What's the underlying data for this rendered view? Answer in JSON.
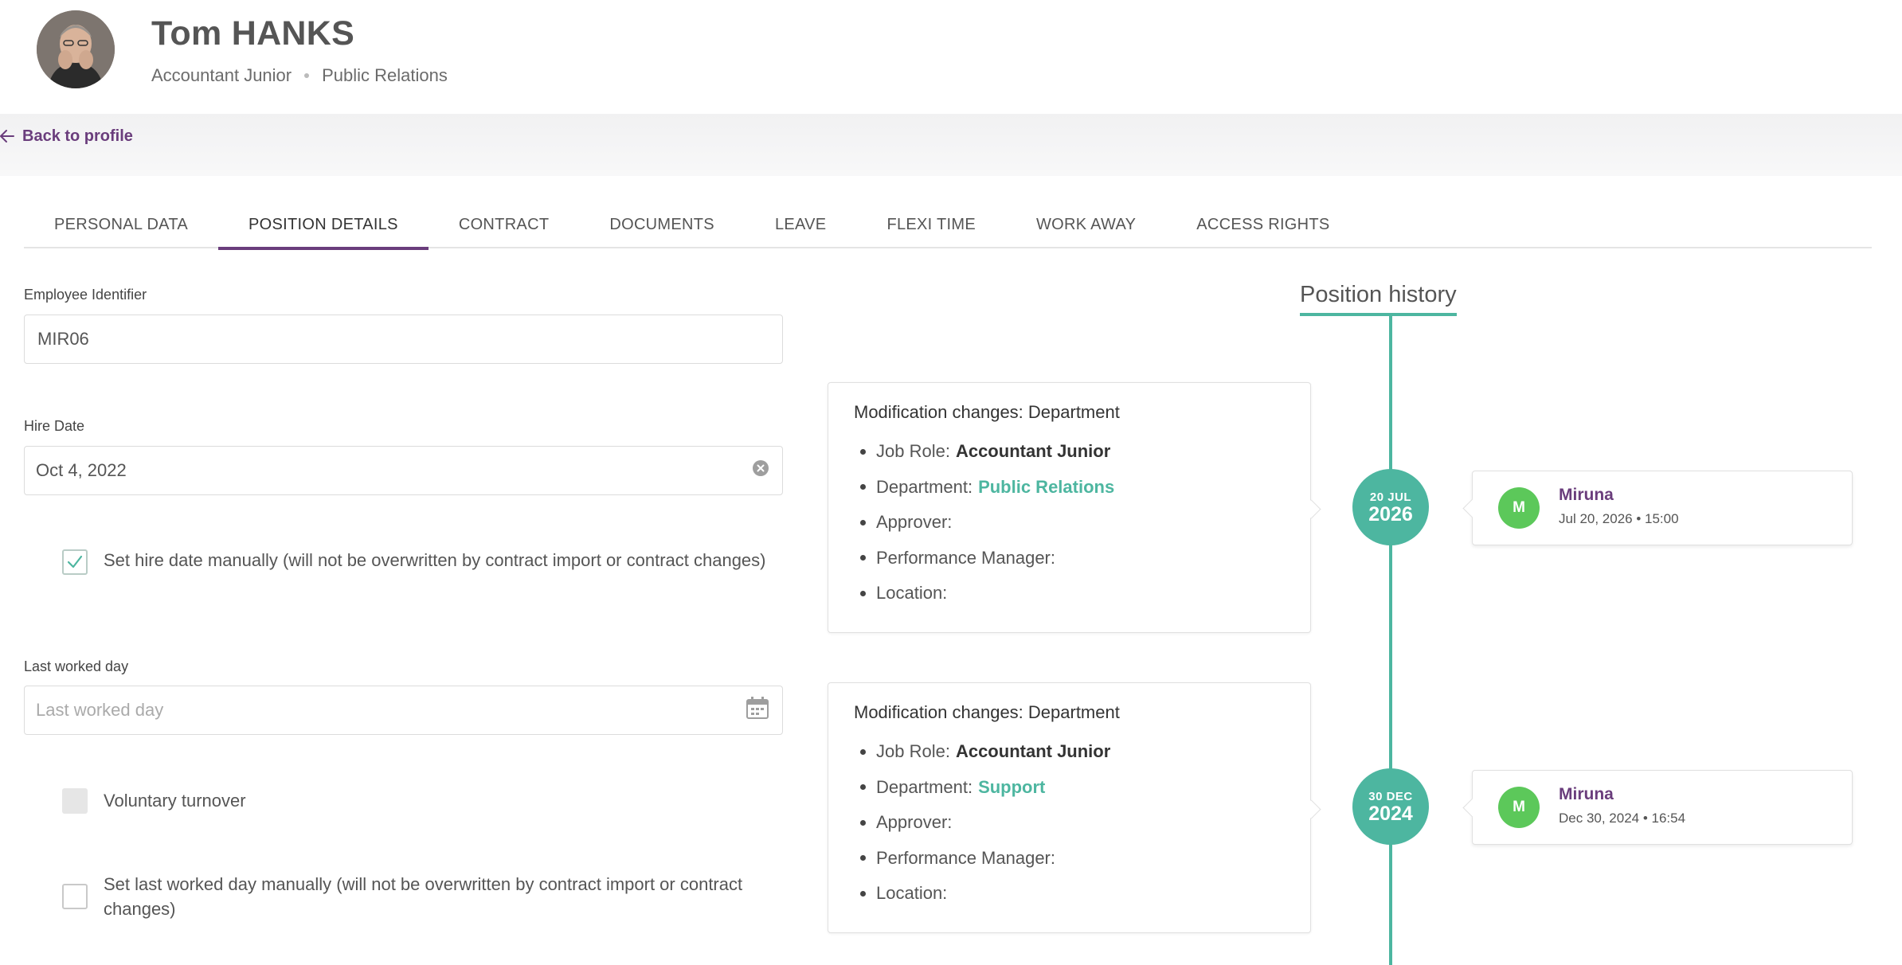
{
  "header": {
    "name": "Tom HANKS",
    "job_role": "Accountant Junior",
    "department": "Public Relations"
  },
  "nav": {
    "back_label": "Back to profile"
  },
  "tabs": [
    {
      "label": "PERSONAL DATA"
    },
    {
      "label": "POSITION DETAILS",
      "active": true
    },
    {
      "label": "CONTRACT"
    },
    {
      "label": "DOCUMENTS"
    },
    {
      "label": "LEAVE"
    },
    {
      "label": "FLEXI TIME"
    },
    {
      "label": "WORK AWAY"
    },
    {
      "label": "ACCESS RIGHTS"
    }
  ],
  "form": {
    "employee_identifier": {
      "label": "Employee Identifier",
      "value": "MIR06"
    },
    "hire_date": {
      "label": "Hire Date",
      "value": "Oct 4, 2022"
    },
    "manual_hire_date": {
      "label": "Set hire date manually (will not be overwritten by contract import or contract changes)",
      "checked": true
    },
    "last_worked_day": {
      "label": "Last worked day",
      "placeholder": "Last worked day"
    },
    "voluntary_turnover": {
      "label": "Voluntary turnover",
      "checked": false,
      "disabled": true
    },
    "manual_last_worked_day": {
      "label": "Set last worked day manually (will not be overwritten by contract import or contract changes)",
      "checked": false
    }
  },
  "history": {
    "title": "Position history",
    "entries": [
      {
        "date_day": "20 JUL",
        "date_year": "2026",
        "title": "Modification changes: Department",
        "fields": {
          "job_role_label": "Job Role:",
          "job_role": "Accountant Junior",
          "department_label": "Department:",
          "department": "Public Relations",
          "approver_label": "Approver:",
          "performance_manager_label": "Performance Manager:",
          "location_label": "Location:"
        },
        "author_initial": "M",
        "author_name": "Miruna",
        "author_time": "Jul 20, 2026 • 15:00"
      },
      {
        "date_day": "30 DEC",
        "date_year": "2024",
        "title": "Modification changes: Department",
        "fields": {
          "job_role_label": "Job Role:",
          "job_role": "Accountant Junior",
          "department_label": "Department:",
          "department": "Support",
          "approver_label": "Approver:",
          "performance_manager_label": "Performance Manager:",
          "location_label": "Location:"
        },
        "author_initial": "M",
        "author_name": "Miruna",
        "author_time": "Dec 30, 2024 • 16:54"
      }
    ]
  },
  "colors": {
    "brand_purple": "#6a3d7c",
    "timeline_teal": "#4db6a0",
    "author_green": "#5cc85a"
  }
}
